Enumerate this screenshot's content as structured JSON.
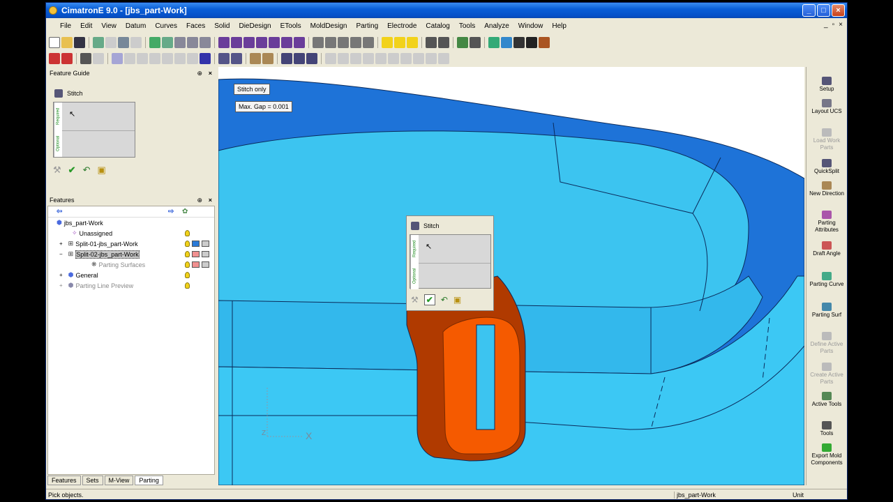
{
  "window": {
    "title": "CimatronE 9.0 - [jbs_part-Work]"
  },
  "menu": [
    "File",
    "Edit",
    "View",
    "Datum",
    "Curves",
    "Faces",
    "Solid",
    "DieDesign",
    "ETools",
    "MoldDesign",
    "Parting",
    "Electrode",
    "Catalog",
    "Tools",
    "Analyze",
    "Window",
    "Help"
  ],
  "feature_guide": {
    "title": "Feature Guide",
    "feature": "Stitch",
    "required_tab": "Required",
    "optional_tab": "Optional"
  },
  "features_panel": {
    "title": "Features",
    "rows": [
      {
        "label": "jbs_part-Work"
      },
      {
        "label": "Unassigned"
      },
      {
        "label": "Split-01-jbs_part-Work"
      },
      {
        "label": "Split-02-jbs_part-Work"
      },
      {
        "label": "Parting Surfaces"
      },
      {
        "label": "General"
      },
      {
        "label": "Parting Line Preview"
      }
    ]
  },
  "bottom_tabs": [
    "Features",
    "Sets",
    "M-View",
    "Parting"
  ],
  "viewport": {
    "label_mode": "Stitch only",
    "label_gap": "Max. Gap = 0.001",
    "axis_x": "X",
    "axis_z": "Z"
  },
  "popup": {
    "title": "Stitch",
    "required_tab": "Required",
    "optional_tab": "Optional"
  },
  "right_toolbar": [
    {
      "label": "Setup",
      "disabled": false
    },
    {
      "label": "Layout UCS",
      "disabled": false
    },
    {
      "label": "Load Work Parts",
      "disabled": true
    },
    {
      "label": "QuickSplit",
      "disabled": false
    },
    {
      "label": "New Direction",
      "disabled": false
    },
    {
      "label": "Parting Attributes",
      "disabled": false
    },
    {
      "label": "Draft Angle",
      "disabled": false
    },
    {
      "label": "Parting Curve",
      "disabled": false
    },
    {
      "label": "Parting Surf",
      "disabled": false
    },
    {
      "label": "Define Active Parts",
      "disabled": true
    },
    {
      "label": "Create Active Parts",
      "disabled": true
    },
    {
      "label": "Active Tools",
      "disabled": false
    },
    {
      "label": "Tools",
      "disabled": false
    },
    {
      "label": "Export Mold Components",
      "disabled": false
    }
  ],
  "status": {
    "message": "Pick objects.",
    "part": "jbs_part-Work",
    "units": "Unit"
  },
  "colors": {
    "model_blue": "#1e73d8",
    "model_light": "#3cc4f0",
    "clip_orange": "#f55a00",
    "clip_dark": "#b03a00"
  }
}
